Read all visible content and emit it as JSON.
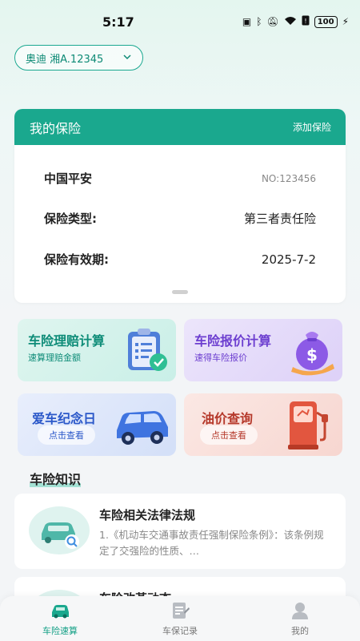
{
  "status_bar": {
    "time": "5:17",
    "battery": "100"
  },
  "car_selector": {
    "value": "奥迪 湘A.12345"
  },
  "insurance_card": {
    "title": "我的保险",
    "add_label": "添加保险",
    "company": "中国平安",
    "policy_no": "NO:123456",
    "type_label": "保险类型:",
    "type_value": "第三者责任险",
    "validity_label": "保险有效期:",
    "validity_value": "2025-7-2"
  },
  "tiles": [
    {
      "title": "车险理赔计算",
      "subtitle": "速算理赔金额",
      "icon": "clipboard-check-icon",
      "accent": "#0e8c78"
    },
    {
      "title": "车险报价计算",
      "subtitle": "速得车险报价",
      "icon": "money-bag-icon",
      "accent": "#6d3fd0"
    },
    {
      "title": "爱车纪念日",
      "button": "点击查看",
      "icon": "blue-car-icon",
      "accent": "#2b58c9"
    },
    {
      "title": "油价查询",
      "button": "点击查看",
      "icon": "fuel-pump-icon",
      "accent": "#b5382a"
    }
  ],
  "knowledge": {
    "section_title": "车险知识",
    "items": [
      {
        "title": "车险相关法律法规",
        "desc": "1.《机动车交通事故责任强制保险条例》：该条例规定了交强险的性质、…"
      },
      {
        "title": "车险改革动态",
        "desc": ""
      }
    ]
  },
  "bottom_nav": [
    {
      "label": "车险速算",
      "icon": "car-icon",
      "active": true
    },
    {
      "label": "车保记录",
      "icon": "record-icon",
      "active": false
    },
    {
      "label": "我的",
      "icon": "user-icon",
      "active": false
    }
  ],
  "colors": {
    "primary": "#1aa88e",
    "background": "#f3f5f7"
  }
}
